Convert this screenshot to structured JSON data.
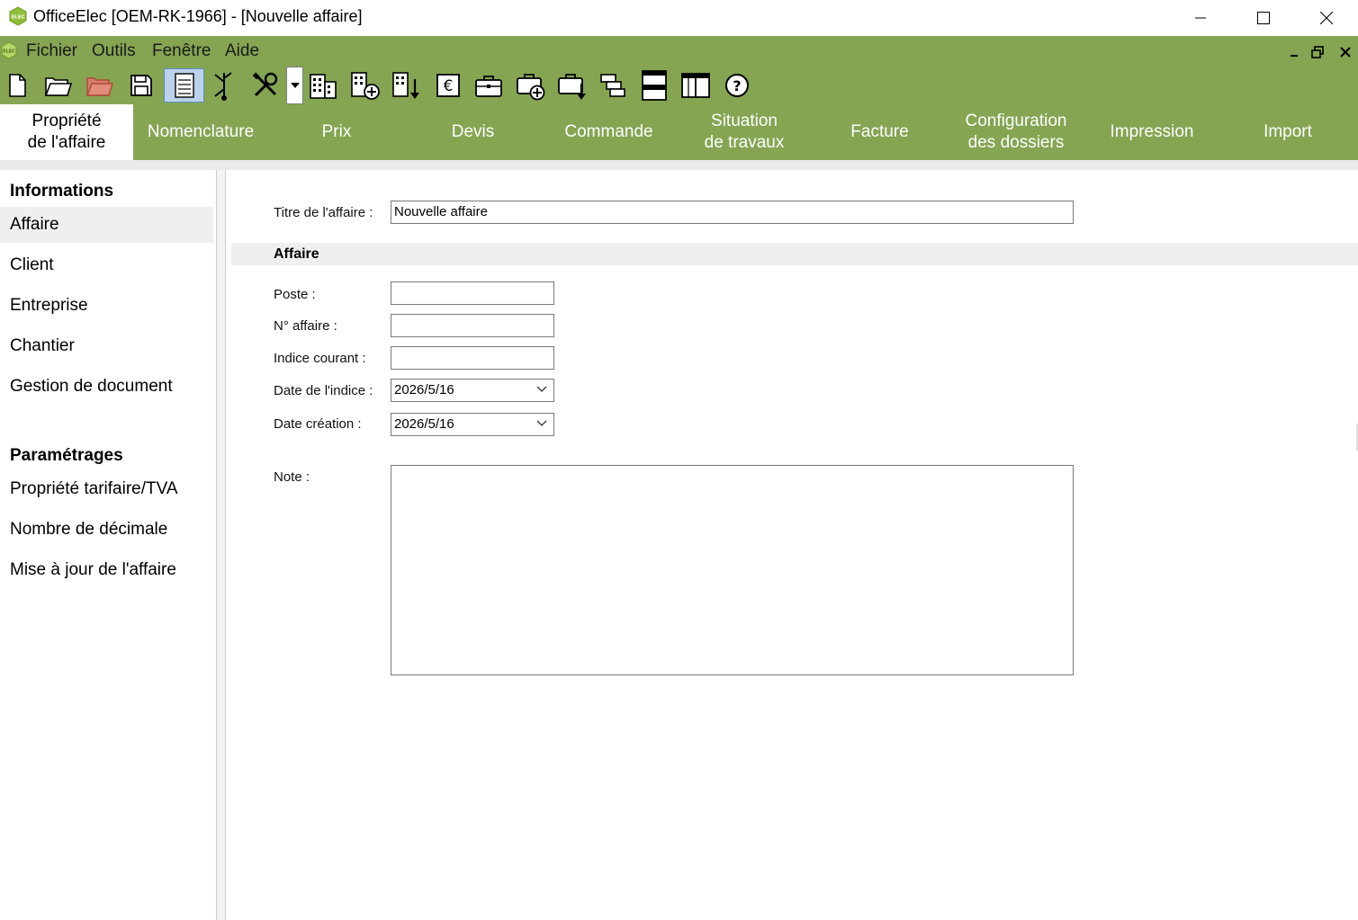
{
  "window": {
    "title": "OfficeElec [OEM-RK-1966] - [Nouvelle affaire]",
    "logo_text": "ELEC"
  },
  "menu": {
    "items": [
      {
        "label": "Fichier"
      },
      {
        "label": "Outils"
      },
      {
        "label": "Fenêtre"
      },
      {
        "label": "Aide"
      }
    ]
  },
  "toolbar": {
    "icons": [
      "new-file-icon",
      "open-folder-icon",
      "open-folder-red-icon",
      "save-icon",
      "list-view-icon",
      "tree-branch-icon",
      "tools-icon",
      "dropdown-arrow-icon",
      "building-icon",
      "building-add-icon",
      "building-import-icon",
      "euro-icon",
      "briefcase-icon",
      "briefcase-add-icon",
      "briefcase-export-icon",
      "stacked-windows-icon",
      "tile-horizontal-icon",
      "tile-vertical-icon",
      "help-icon"
    ]
  },
  "tabs": [
    {
      "label": "Propriété\nde l'affaire",
      "active": true
    },
    {
      "label": "Nomenclature"
    },
    {
      "label": "Prix"
    },
    {
      "label": "Devis"
    },
    {
      "label": "Commande"
    },
    {
      "label": "Situation\nde travaux"
    },
    {
      "label": "Facture"
    },
    {
      "label": "Configuration\ndes dossiers"
    },
    {
      "label": "Impression"
    },
    {
      "label": "Import"
    }
  ],
  "sidebar": {
    "informations_heading": "Informations",
    "informations_items": [
      {
        "label": "Affaire",
        "selected": true
      },
      {
        "label": "Client"
      },
      {
        "label": "Entreprise"
      },
      {
        "label": "Chantier"
      },
      {
        "label": "Gestion de document"
      }
    ],
    "parametrages_heading": "Paramétrages",
    "parametrages_items": [
      {
        "label": "Propriété tarifaire/TVA"
      },
      {
        "label": "Nombre de décimale"
      },
      {
        "label": "Mise à jour de l'affaire"
      }
    ]
  },
  "form": {
    "titre_label": "Titre de l'affaire :",
    "titre_value": "Nouvelle affaire",
    "section_title": "Affaire",
    "poste_label": "Poste :",
    "poste_value": "",
    "numero_label": "N° affaire :",
    "numero_value": "",
    "indice_label": "Indice courant :",
    "indice_value": "",
    "date_indice_label": "Date de l'indice :",
    "date_indice_value": "2026/5/16",
    "date_creation_label": "Date création :",
    "date_creation_value": "2026/5/16",
    "note_label": "Note :",
    "note_value": ""
  },
  "colors": {
    "accent_green": "#85a552",
    "selected_bg": "#efefef"
  }
}
